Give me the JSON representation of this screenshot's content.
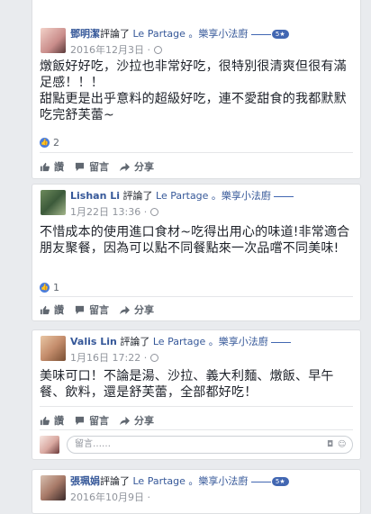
{
  "common": {
    "reviewed_text": "評論了",
    "page_name": "Le Partage 。樂享小法廚",
    "badge": "5★",
    "like_label": "讚",
    "comment_label": "留言",
    "share_label": "分享",
    "comment_placeholder": "留言……"
  },
  "reviews": [
    {
      "author": "鄧明潔",
      "date": "2016年12月3日 ·",
      "text": "燉飯好好吃，沙拉也非常好吃，很特別很清爽但很有滿足感！！！\n甜點更是出乎意料的超級好吃，連不愛甜食的我都默默吃完舒芙蕾~",
      "likes": "2"
    },
    {
      "author": "Lishan Li",
      "date": "1月22日 13:36 ·",
      "text": "不惜成本的使用進口食材~吃得出用心的味道!非常適合朋友聚餐，因為可以點不同餐點來一次品嚐不同美味!",
      "likes": "1"
    },
    {
      "author": "Valis Lin",
      "date": "1月16日 17:22 ·",
      "text": "美味可口！不論是湯、沙拉、義大利麵、燉飯、早午餐、飲料，還是舒芙蕾，全部都好吃！",
      "likes": ""
    },
    {
      "author": "張珮娟",
      "date": "2016年10月9日 ·",
      "text": "",
      "likes": ""
    }
  ],
  "colors": {
    "link": "#365899",
    "fb_blue": "#4267b2",
    "meta": "#90949c"
  },
  "icons": [
    "thumbs-up-icon",
    "comment-icon",
    "share-icon",
    "globe-icon",
    "camera-icon",
    "emoji-icon"
  ]
}
